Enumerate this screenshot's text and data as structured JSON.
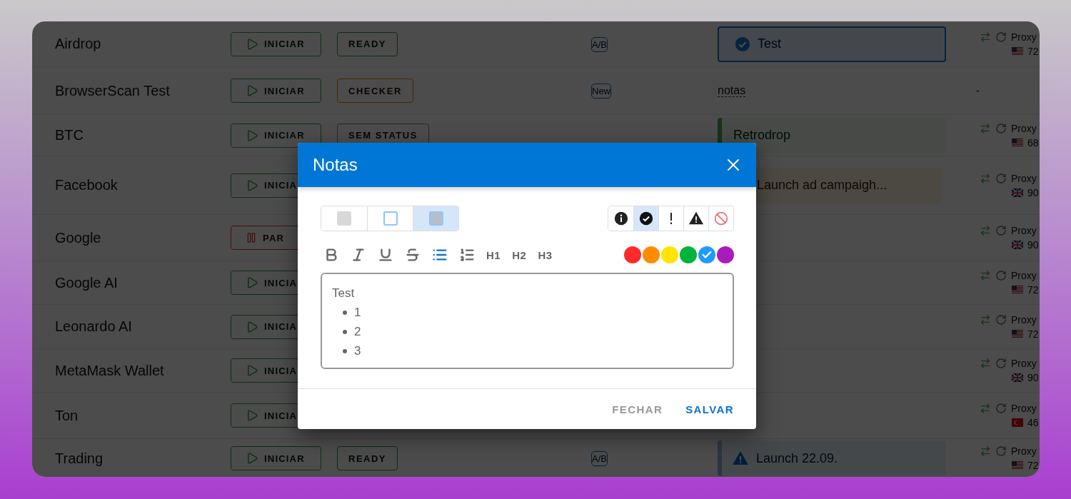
{
  "rows": [
    {
      "name": "Airdrop",
      "start": {
        "label": "INICIAR",
        "kind": "play"
      },
      "status": {
        "label": "READY",
        "kind": "ready"
      },
      "tag": {
        "label": "A/B"
      },
      "note": {
        "text": "Test",
        "kind": "check"
      },
      "proxy": {
        "label": "Proxy",
        "kind": "us",
        "count": "72"
      }
    },
    {
      "name": "BrowserScan Test",
      "start": {
        "label": "INICIAR",
        "kind": "play"
      },
      "status": {
        "label": "CHECKER",
        "kind": "checker"
      },
      "tag": {
        "label": "New"
      },
      "note": {
        "text": "notas",
        "kind": "link"
      },
      "proxy": {
        "missing": "-"
      }
    },
    {
      "name": "BTC",
      "start": {
        "label": "INICIAR",
        "kind": "play"
      },
      "status": {
        "label": "SEM STATUS",
        "kind": "none"
      },
      "note": {
        "text": "Retrodrop",
        "kind": "green"
      },
      "proxy": {
        "label": "Proxy",
        "kind": "us",
        "count": "68"
      }
    },
    {
      "name": "Facebook",
      "start": {
        "label": "INICIA",
        "kind": "play"
      },
      "note": {
        "text": "Launch ad campaigh...",
        "kind": "orange"
      },
      "proxy": {
        "label": "Proxy",
        "kind": "uk",
        "count": "90"
      }
    },
    {
      "name": "Google",
      "start": {
        "label": "PAR",
        "kind": "pause"
      },
      "proxy": {
        "label": "Proxy",
        "kind": "uk",
        "count": "90"
      }
    },
    {
      "name": "Google AI",
      "start": {
        "label": "INICIA",
        "kind": "play"
      },
      "proxy": {
        "label": "Proxy",
        "kind": "us",
        "count": "72"
      }
    },
    {
      "name": "Leonardo AI",
      "start": {
        "label": "INICIA",
        "kind": "play"
      },
      "proxy": {
        "label": "Proxy",
        "kind": "us",
        "count": "72"
      }
    },
    {
      "name": "MetaMask Wallet",
      "start": {
        "label": "INICIA",
        "kind": "play"
      },
      "proxy": {
        "label": "Proxy",
        "kind": "uk",
        "count": "90"
      }
    },
    {
      "name": "Ton",
      "start": {
        "label": "INICIA",
        "kind": "play"
      },
      "proxy": {
        "label": "Proxy",
        "kind": "tr",
        "count": "46"
      }
    },
    {
      "name": "Trading",
      "start": {
        "label": "INICIAR",
        "kind": "play"
      },
      "status": {
        "label": "READY",
        "kind": "ready"
      },
      "tag": {
        "label": "A/B"
      },
      "note": {
        "text": "Launch 22.09.",
        "kind": "warning"
      },
      "proxy": {
        "label": "Proxy",
        "kind": "us",
        "count": "72"
      }
    }
  ],
  "modal": {
    "title": "Notas",
    "styles": [
      {
        "kind": "filled",
        "selected": false
      },
      {
        "kind": "outline",
        "selected": false
      },
      {
        "kind": "tinted",
        "selected": true
      }
    ],
    "icons": [
      {
        "kind": "info",
        "selected": false
      },
      {
        "kind": "check",
        "selected": true
      },
      {
        "kind": "exclaim",
        "selected": false
      },
      {
        "kind": "warning",
        "selected": false
      },
      {
        "kind": "ban",
        "selected": false
      }
    ],
    "format": [
      {
        "kind": "bold",
        "active": false
      },
      {
        "kind": "italic",
        "active": false
      },
      {
        "kind": "underline",
        "active": false
      },
      {
        "kind": "strike",
        "active": false
      },
      {
        "kind": "bullets",
        "active": true
      },
      {
        "kind": "numbered",
        "active": false
      },
      {
        "kind": "heading",
        "label": "H1",
        "active": false
      },
      {
        "kind": "heading",
        "label": "H2",
        "active": false
      },
      {
        "kind": "heading",
        "label": "H3",
        "active": false
      }
    ],
    "colors": [
      {
        "color": "#ff2a2a",
        "selected": false
      },
      {
        "color": "#ff8c00",
        "selected": false
      },
      {
        "color": "#ffe500",
        "selected": false
      },
      {
        "color": "#00b33c",
        "selected": false
      },
      {
        "color": "#1e9bff",
        "selected": true
      },
      {
        "color": "#a81bbf",
        "selected": false
      }
    ],
    "editor": {
      "paragraph": "Test",
      "bullets": [
        "1",
        "2",
        "3"
      ]
    },
    "buttons": [
      {
        "label": "FECHAR",
        "kind": "secondary"
      },
      {
        "label": "SALVAR",
        "kind": "primary"
      }
    ]
  }
}
